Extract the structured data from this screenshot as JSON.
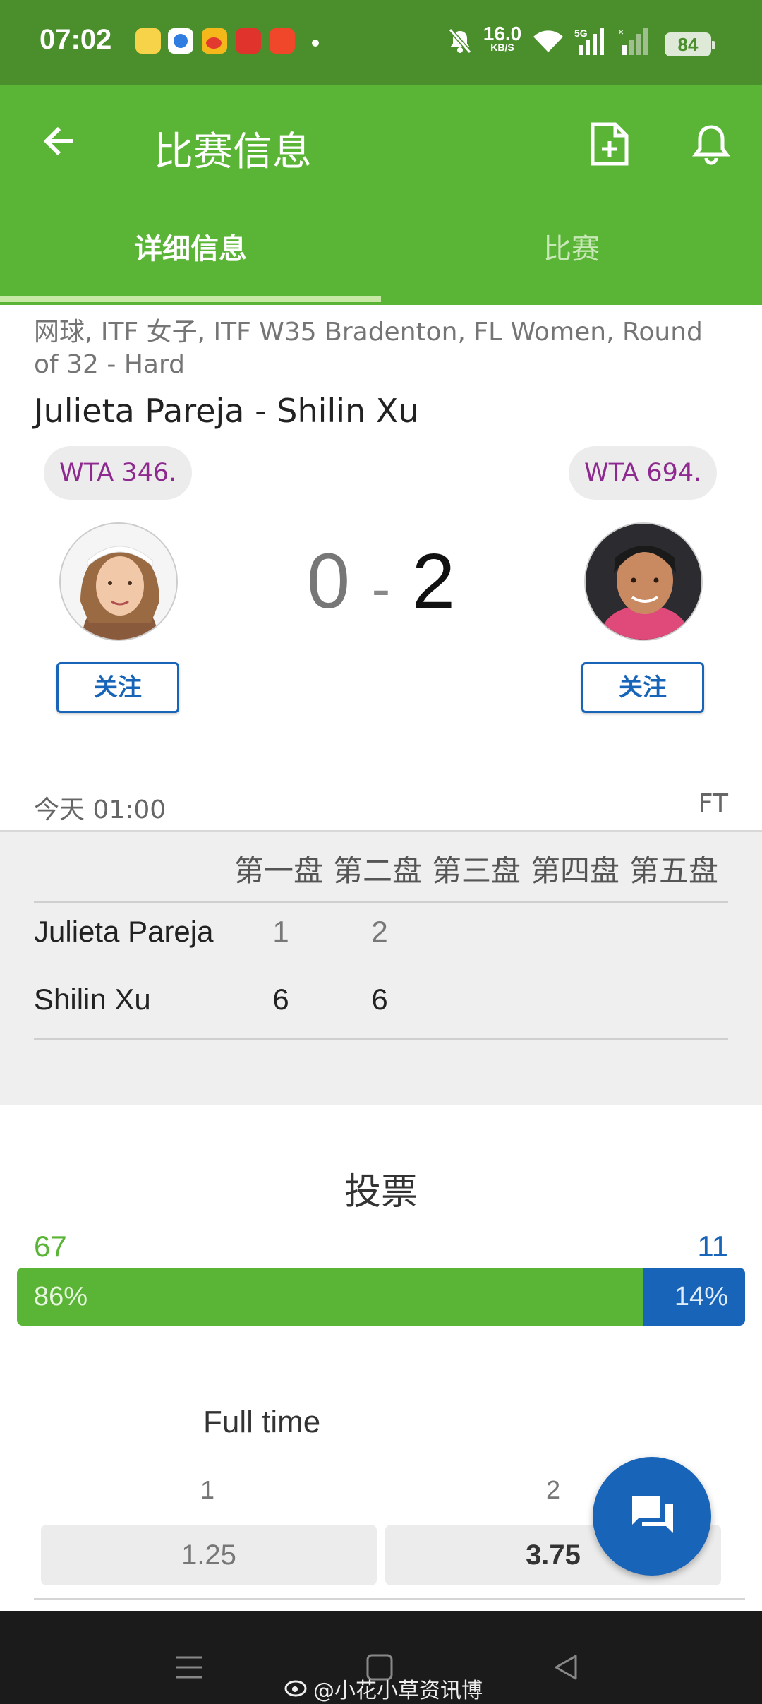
{
  "status_bar": {
    "time": "07:02",
    "net_speed": "16.0",
    "net_unit": "KB/S",
    "network": "5G",
    "battery": "84"
  },
  "app_bar": {
    "title": "比赛信息",
    "back_icon": "arrow-left-icon",
    "actions": [
      "add-document-icon",
      "bell-icon"
    ],
    "tabs": [
      {
        "label": "详细信息",
        "active": true
      },
      {
        "label": "比赛",
        "active": false
      }
    ]
  },
  "match": {
    "competition": "网球, ITF 女子, ITF W35 Bradenton, FL Women, Round of 32 - Hard",
    "name": "Julieta Pareja - Shilin Xu",
    "home": {
      "ranking": "WTA 346.",
      "follow_label": "关注"
    },
    "away": {
      "ranking": "WTA 694.",
      "follow_label": "关注"
    },
    "score_home": "0",
    "score_separator": "-",
    "score_away": "2",
    "start_time": "今天 01:00",
    "status": "FT"
  },
  "sets": {
    "headers": [
      "第一盘",
      "第二盘",
      "第三盘",
      "第四盘",
      "第五盘"
    ],
    "rows": [
      {
        "player": "Julieta Pareja",
        "scores": [
          "1",
          "2"
        ]
      },
      {
        "player": "Shilin Xu",
        "scores": [
          "6",
          "6"
        ]
      }
    ]
  },
  "vote": {
    "title": "投票",
    "home_count": "67",
    "away_count": "11",
    "home_pct_label": "86%",
    "away_pct_label": "14%",
    "home_share": 0.86,
    "colors": {
      "home": "#5ab536",
      "away": "#1764b8"
    }
  },
  "odds": {
    "title": "Full time",
    "labels": [
      "1",
      "2"
    ],
    "values": [
      "1.25",
      "3.75"
    ]
  },
  "fab_icon": "chat-icon",
  "watermark": "@小花小草资讯博"
}
